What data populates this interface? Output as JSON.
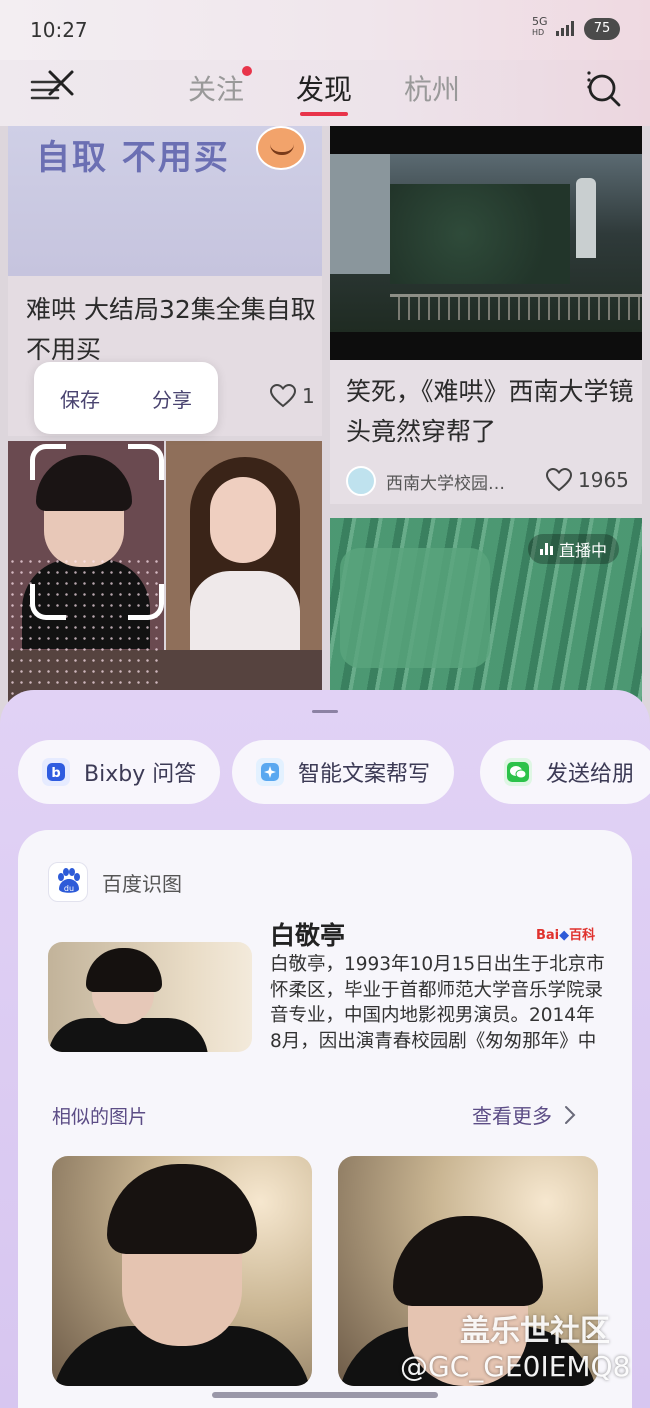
{
  "status_bar": {
    "time": "10:27",
    "network": "5G",
    "network_sub": "HD",
    "battery": "75"
  },
  "nav": {
    "tabs": [
      {
        "label": "关注",
        "active": false,
        "has_dot": true
      },
      {
        "label": "发现",
        "active": true,
        "has_dot": false
      },
      {
        "label": "杭州",
        "active": false,
        "has_dot": false
      }
    ],
    "menu_icon": "menu-close-icon",
    "search_icon": "search-icon",
    "accent_color": "#e8344a"
  },
  "feed": {
    "left_card": {
      "banner_text": "自取 不用买",
      "title": "难哄 大结局32集全集自取 不用买",
      "likes": "1"
    },
    "right_card": {
      "title": "笑死，《难哄》西南大学镜头竟然穿帮了",
      "author": "西南大学校园…",
      "likes": "1965"
    },
    "live_card": {
      "badge": "直播中"
    }
  },
  "selection_popup": {
    "save": "保存",
    "share": "分享"
  },
  "sheet": {
    "chips": [
      {
        "label": "Bixby 问答",
        "icon": "bixby-icon"
      },
      {
        "label": "智能文案帮写",
        "icon": "ai-writing-icon"
      },
      {
        "label": "发送给朋",
        "icon": "wechat-icon"
      }
    ],
    "baidu": {
      "source": "百度识图",
      "logo_text": "du",
      "baike_label": "Bai",
      "baike_suffix": "百科",
      "name": "白敬亭",
      "description": "白敬亭，1993年10月15日出生于北京市怀柔区，毕业于首都师范大学音乐学院录音专业，中国内地影视男演员。2014年8月，因出演青春校园剧《匆匆那年》中乔燃一角进…",
      "similar_title": "相似的图片",
      "view_more": "查看更多"
    }
  },
  "watermark": {
    "line1": "盖乐世社区",
    "line2": "@GC_GE0IEMQ8"
  }
}
